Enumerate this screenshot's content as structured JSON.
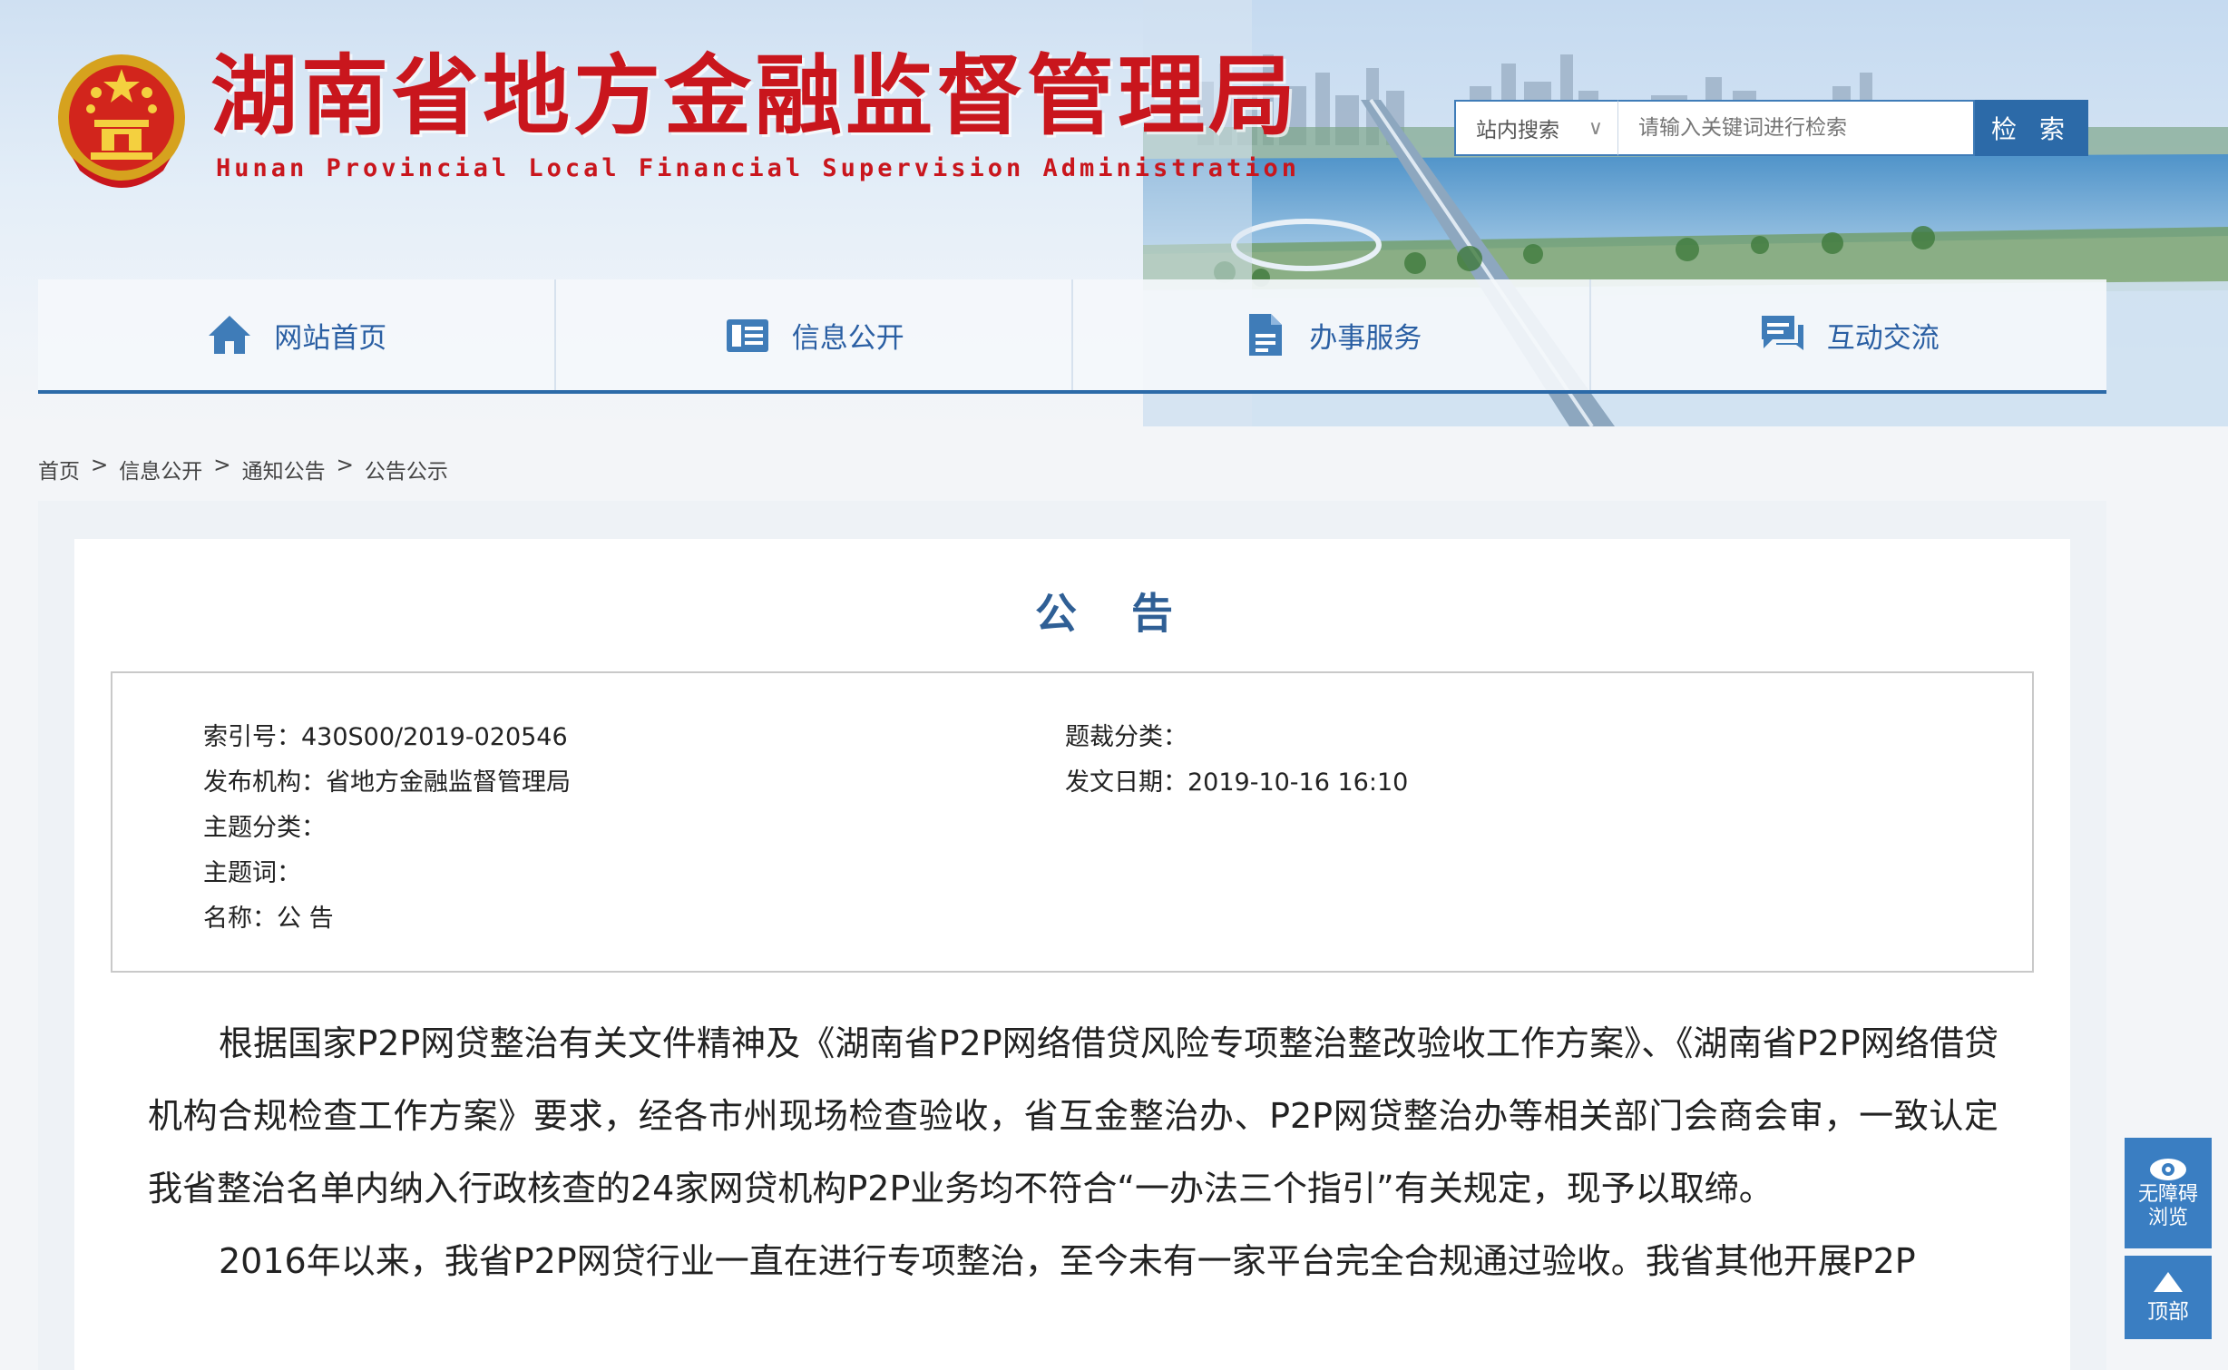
{
  "header": {
    "title": "湖南省地方金融监督管理局",
    "subtitle": "Hunan Provincial Local Financial Supervision Administration",
    "emblem_icon": "national-emblem-icon"
  },
  "search": {
    "scope": "站内搜索",
    "placeholder": "请输入关键词进行检索",
    "button": "检 索"
  },
  "nav": {
    "items": [
      {
        "label": "网站首页",
        "icon": "home-icon"
      },
      {
        "label": "信息公开",
        "icon": "info-board-icon"
      },
      {
        "label": "办事服务",
        "icon": "document-icon"
      },
      {
        "label": "互动交流",
        "icon": "chat-icon"
      }
    ]
  },
  "breadcrumb": [
    "首页",
    "信息公开",
    "通知公告",
    "公告公示"
  ],
  "breadcrumb_sep": ">",
  "article": {
    "title": "公 告",
    "meta": {
      "index_label": "索引号：",
      "index_value": "430S00/2019-020546",
      "genre_label": "题裁分类：",
      "genre_value": "",
      "publisher_label": "发布机构：",
      "publisher_value": "省地方金融监督管理局",
      "date_label": "发文日期：",
      "date_value": "2019-10-16 16:10",
      "topic_label": "主题分类：",
      "topic_value": "",
      "keyword_label": "主题词：",
      "keyword_value": "",
      "name_label": "名称：",
      "name_value": "公 告"
    },
    "paragraphs": [
      "根据国家P2P网贷整治有关文件精神及《湖南省P2P网络借贷风险专项整治整改验收工作方案》、《湖南省P2P网络借贷机构合规检查工作方案》要求，经各市州现场检查验收，省互金整治办、P2P网贷整治办等相关部门会商会审，一致认定我省整治名单内纳入行政核查的24家网贷机构P2P业务均不符合“一办法三个指引”有关规定，现予以取缔。",
      "2016年以来，我省P2P网贷行业一直在进行专项整治，至今未有一家平台完全合规通过验收。我省其他开展P2P"
    ]
  },
  "tools": {
    "accessibility": "无障碍\n浏览",
    "accessibility_line1": "无障碍",
    "accessibility_line2": "浏览",
    "back_to_top": "顶部",
    "accessibility_icon": "eye-icon",
    "top_icon": "arrow-up-icon"
  },
  "colors": {
    "title_red": "#c9161d",
    "accent_blue": "#2c6aa8",
    "nav_text": "#2a5fa3",
    "article_title": "#2f5f95"
  }
}
